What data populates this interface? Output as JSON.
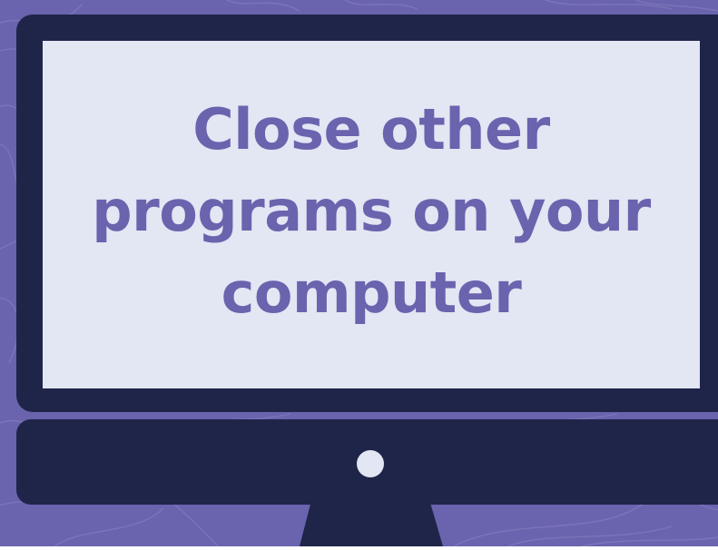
{
  "slide": {
    "message": "Close other programs on your computer"
  },
  "colors": {
    "background": "#6a63ae",
    "contour_lines": "#7d77bb",
    "monitor_frame": "#1f2549",
    "screen": "#e3e6f3",
    "text": "#6a63ae",
    "power_button": "#e3e6f3"
  }
}
